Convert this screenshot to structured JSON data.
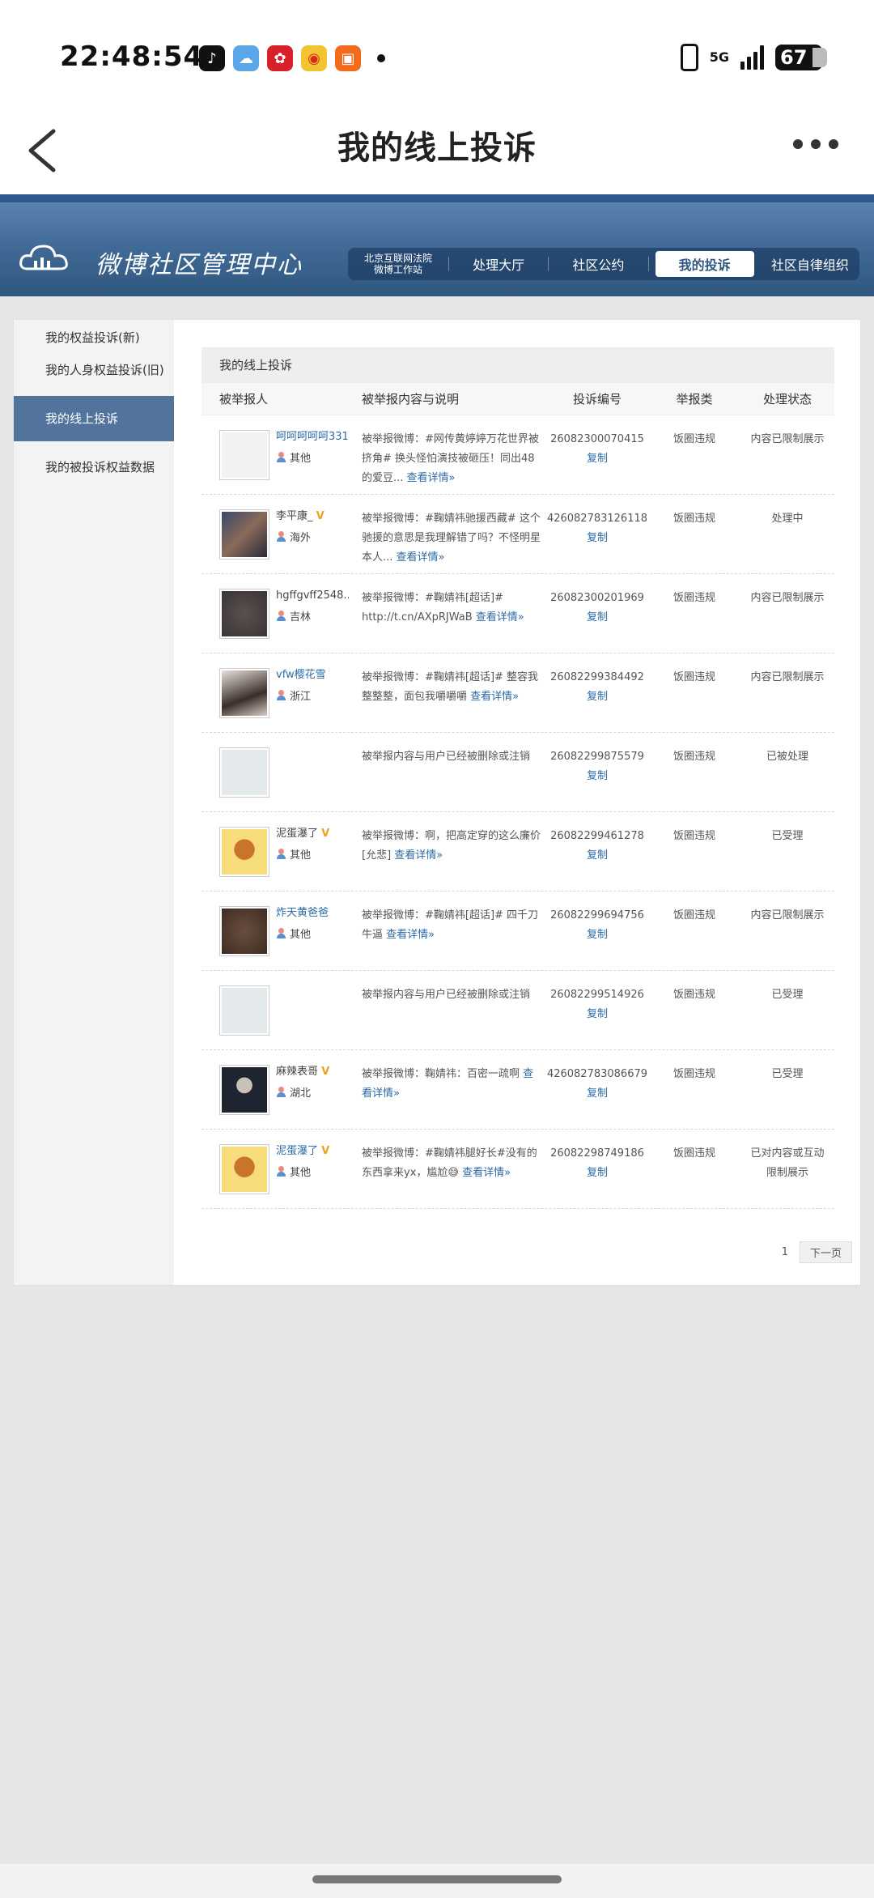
{
  "status_bar": {
    "time": "22:48:54",
    "network": "5G",
    "battery": "67",
    "app_icons": [
      "tiktok-icon",
      "weather-icon",
      "vip-icon",
      "weibo-icon",
      "kuaishou-icon"
    ]
  },
  "navbar": {
    "title": "我的线上投诉"
  },
  "weibo_header": {
    "title": "微博社区管理中心",
    "police_line1": "北京互联网法院",
    "police_line2": "微博工作站",
    "menu": [
      "处理大厅",
      "社区公约",
      "我的投诉",
      "社区自律组织"
    ],
    "active_menu": "我的投诉"
  },
  "sidebar": {
    "items": [
      "我的权益投诉(新)",
      "我的人身权益投诉(旧)",
      "我的线上投诉",
      "我的被投诉权益数据"
    ]
  },
  "main": {
    "title": "我的线上投诉",
    "headers": [
      "被举报人",
      "被举报内容与说明",
      "投诉编号",
      "举报类",
      "处理状态"
    ],
    "copy_label": "复制",
    "more_label": "查看详情»",
    "rows": [
      {
        "name": "呵呵呵呵呵331",
        "link": true,
        "v": "",
        "loc": "其他",
        "desc": "被举报微博：#网传黄婷婷万花世界被挤角# 换头怪怕演技被砸压！同出48的爱豆...",
        "more": "查看详情»",
        "id": "26082300070415",
        "type": "饭圈违规",
        "status": "内容已限制展示",
        "avatar": "blank"
      },
      {
        "name": "李平康_",
        "link": false,
        "v": "V",
        "loc": "海外",
        "desc": "被举报微博：#鞠婧祎驰援西藏# 这个驰援的意思是我理解错了吗？不怪明星本人...",
        "more": "查看详情»",
        "id": "426082783126118",
        "type": "饭圈违规",
        "status": "处理中",
        "avatar": "photo"
      },
      {
        "name": "hgffgvff2548...",
        "link": false,
        "v": "",
        "loc": "吉林",
        "desc": "被举报微博：#鞠婧祎[超话]# http://t.cn/AXpRJWaB",
        "more": "查看详情»",
        "id": "26082300201969",
        "type": "饭圈违规",
        "status": "内容已限制展示",
        "avatar": "dark"
      },
      {
        "name": "vfw樱花雪",
        "link": true,
        "v": "",
        "loc": "浙江",
        "desc": "被举报微博：#鞠婧祎[超话]# 整容我整整整，面包我嚼嚼嚼",
        "more": "查看详情»",
        "id": "26082299384492",
        "type": "饭圈违规",
        "status": "内容已限制展示",
        "avatar": "girl"
      },
      {
        "name": "",
        "link": false,
        "v": "",
        "loc": "",
        "desc": "被举报内容与用户已经被删除或注销",
        "more": "",
        "id": "26082299875579",
        "type": "饭圈违规",
        "status": "已被处理",
        "avatar": "default"
      },
      {
        "name": "泥蛋瀑了",
        "link": false,
        "v": "V",
        "loc": "其他",
        "desc": "被举报微博：啊，把高定穿的这么廉价[允悲]",
        "more": "查看详情»",
        "id": "26082299461278",
        "type": "饭圈违规",
        "status": "已受理",
        "avatar": "cartoon"
      },
      {
        "name": "炸天黄爸爸",
        "link": true,
        "v": "",
        "loc": "其他",
        "desc": "被举报微博：#鞠婧祎[超话]# 四千刀牛逼",
        "more": "查看详情»",
        "id": "26082299694756",
        "type": "饭圈违规",
        "status": "内容已限制展示",
        "avatar": "brown"
      },
      {
        "name": "",
        "link": false,
        "v": "",
        "loc": "",
        "desc": "被举报内容与用户已经被删除或注销",
        "more": "",
        "id": "26082299514926",
        "type": "饭圈违规",
        "status": "已受理",
        "avatar": "default"
      },
      {
        "name": "麻辣表哥",
        "link": false,
        "v": "V",
        "loc": "湖北",
        "desc": "被举报微博：鞠婧祎：百密一疏啊",
        "more": "查看详情»",
        "id": "426082783086679",
        "type": "饭圈违规",
        "status": "已受理",
        "avatar": "face"
      },
      {
        "name": "泥蛋瀑了",
        "link": true,
        "v": "V",
        "loc": "其他",
        "desc": "被举报微博：#鞠婧祎腿好长#没有的东西拿来yx，尴尬😅",
        "more": "查看详情»",
        "id": "26082298749186",
        "type": "饭圈违规",
        "status": "已对内容或互动限制展示",
        "avatar": "cartoon"
      }
    ]
  },
  "pager": {
    "page": "1",
    "next": "下一页"
  }
}
